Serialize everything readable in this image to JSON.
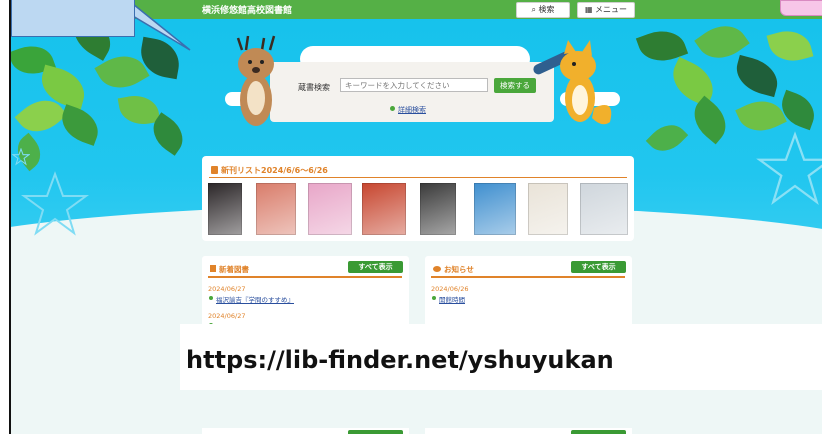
{
  "header": {
    "site_title": "横浜修悠館高校図書館",
    "search_button": "検索",
    "menu_button": "メニュー"
  },
  "search": {
    "label": "蔵書検索",
    "placeholder": "キーワードを入力してください",
    "submit": "検索する",
    "advanced": "詳細検索"
  },
  "new_list": {
    "title": "新刊リスト2024/6/6〜6/26",
    "covers": [
      {
        "name": "cover-1",
        "color": "#2b2628"
      },
      {
        "name": "cover-2",
        "color": "#d97c6a"
      },
      {
        "name": "cover-3",
        "color": "#e8a6c8"
      },
      {
        "name": "cover-4",
        "color": "#c7462f"
      },
      {
        "name": "cover-5",
        "color": "#3a3a3a"
      },
      {
        "name": "cover-6",
        "color": "#3f8fcf"
      },
      {
        "name": "cover-7",
        "color": "#e9e3d8"
      },
      {
        "name": "cover-8",
        "color": "#cfd6dc"
      }
    ]
  },
  "panels": {
    "new_books": {
      "title": "新着図書",
      "all_button": "すべて表示",
      "items": [
        {
          "date": "2024/06/27",
          "text": "福沢諭吉『学問のすすめ』"
        },
        {
          "date": "2024/06/27",
          "text": ""
        }
      ]
    },
    "news": {
      "title": "お知らせ",
      "all_button": "すべて表示",
      "items": [
        {
          "date": "2024/06/26",
          "text": "開館時間"
        }
      ]
    }
  },
  "overlay": {
    "url": "https://lib-finder.net/yshuyukan"
  }
}
